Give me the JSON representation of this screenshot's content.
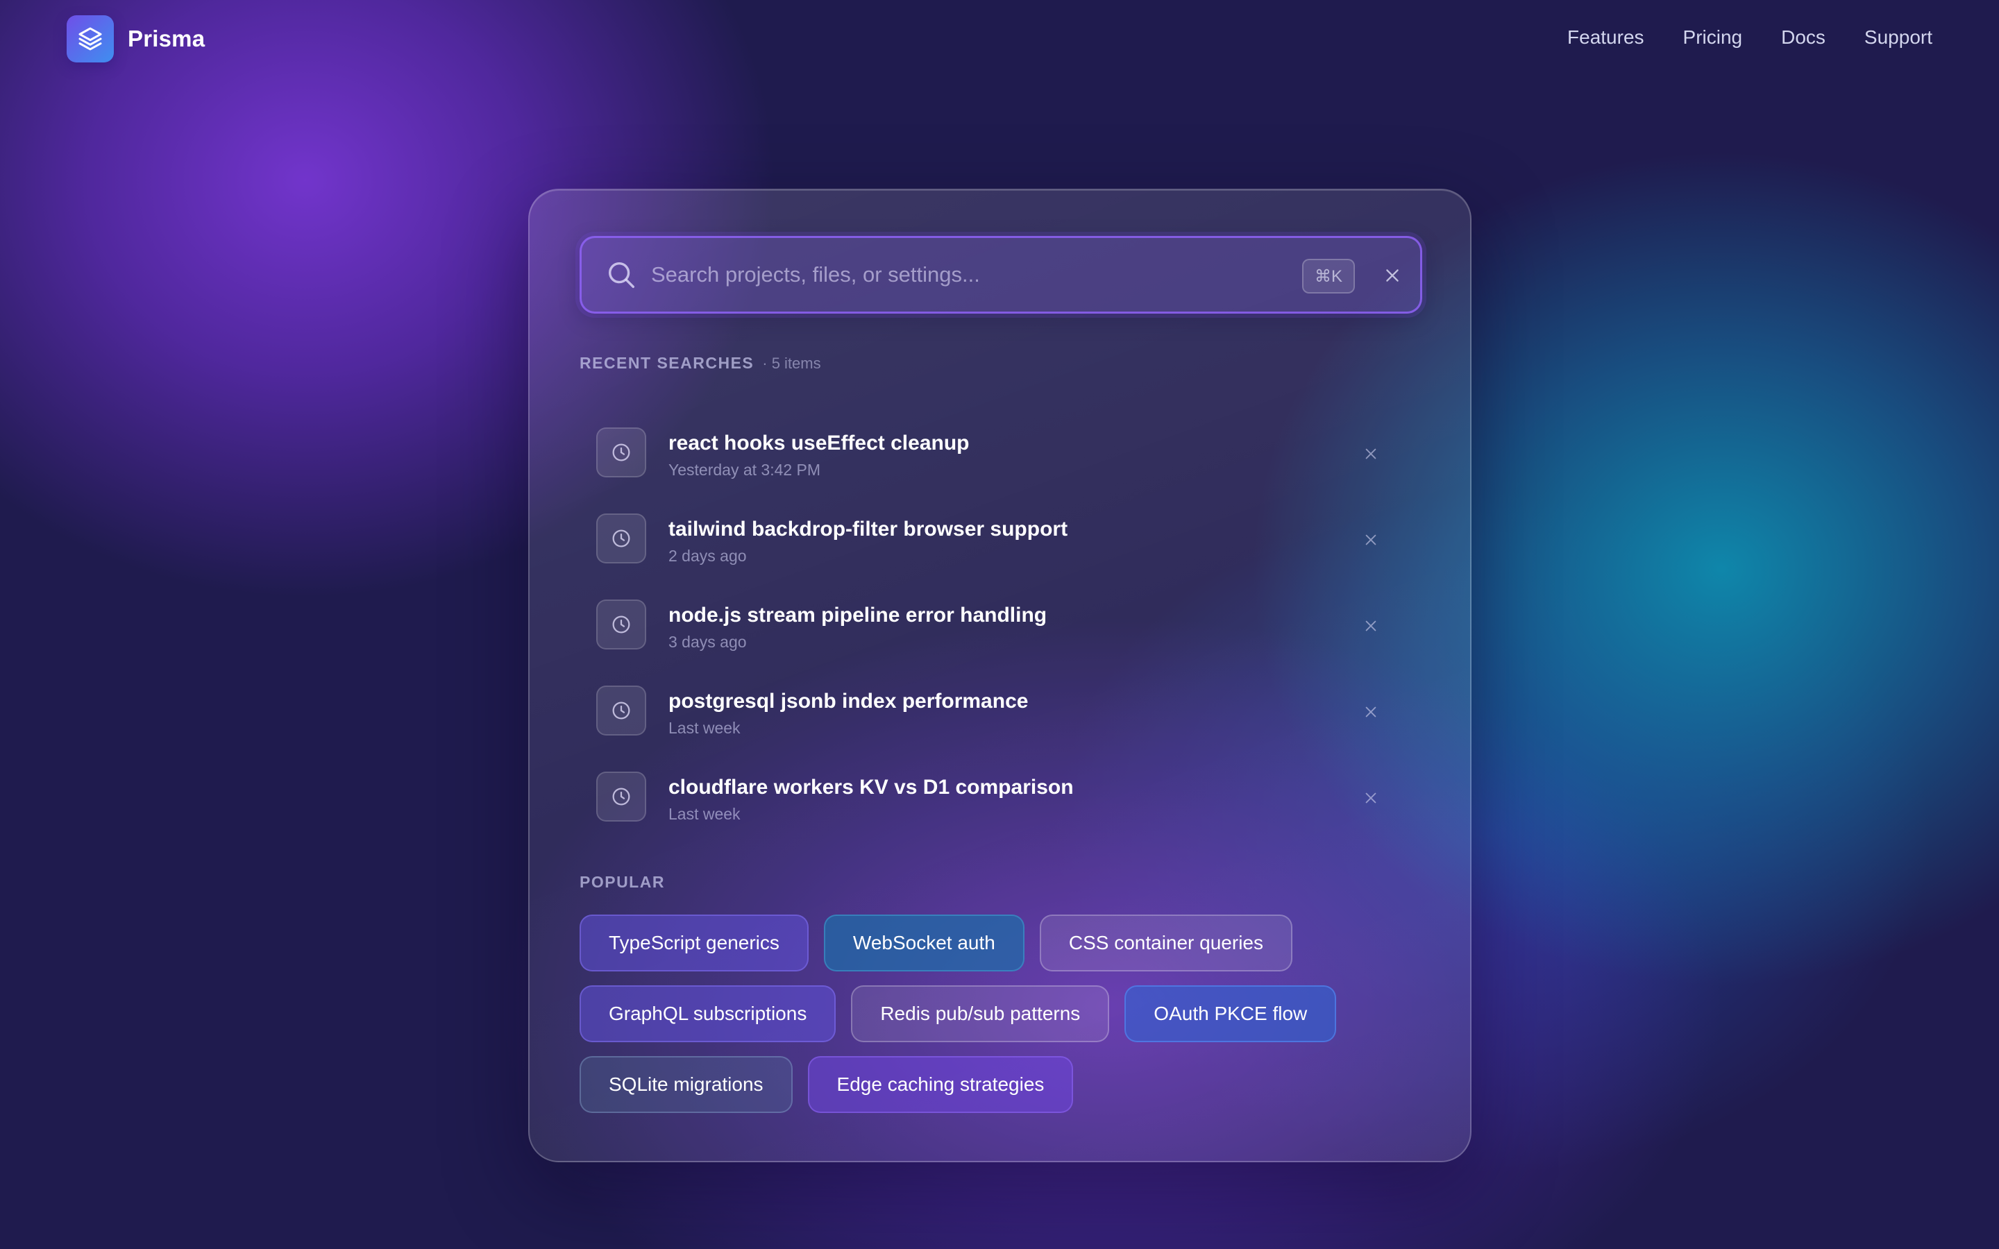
{
  "header": {
    "brand": "Prisma",
    "nav": [
      "Features",
      "Pricing",
      "Docs",
      "Support"
    ]
  },
  "search": {
    "placeholder": "Search projects, files, or settings...",
    "value": "",
    "shortcut": "⌘K"
  },
  "recent": {
    "label": "RECENT SEARCHES",
    "count": "· 5 items",
    "items": [
      {
        "title": "react hooks useEffect cleanup",
        "time": "Yesterday at 3:42 PM"
      },
      {
        "title": "tailwind backdrop-filter browser support",
        "time": "2 days ago"
      },
      {
        "title": "node.js stream pipeline error handling",
        "time": "3 days ago"
      },
      {
        "title": "postgresql jsonb index performance",
        "time": "Last week"
      },
      {
        "title": "cloudflare workers KV vs D1 comparison",
        "time": "Last week"
      }
    ]
  },
  "popular": {
    "label": "POPULAR",
    "chips": [
      "TypeScript generics",
      "WebSocket auth",
      "CSS container queries",
      "GraphQL subscriptions",
      "Redis pub/sub patterns",
      "OAuth PKCE flow",
      "SQLite migrations",
      "Edge caching strategies"
    ]
  },
  "icons": {
    "logo": "layers-icon",
    "search": "search-icon",
    "clear": "close-icon",
    "history": "clock-icon",
    "remove": "close-icon"
  },
  "colors": {
    "accent": "#8e62f5",
    "background": "#1f1b4e"
  }
}
